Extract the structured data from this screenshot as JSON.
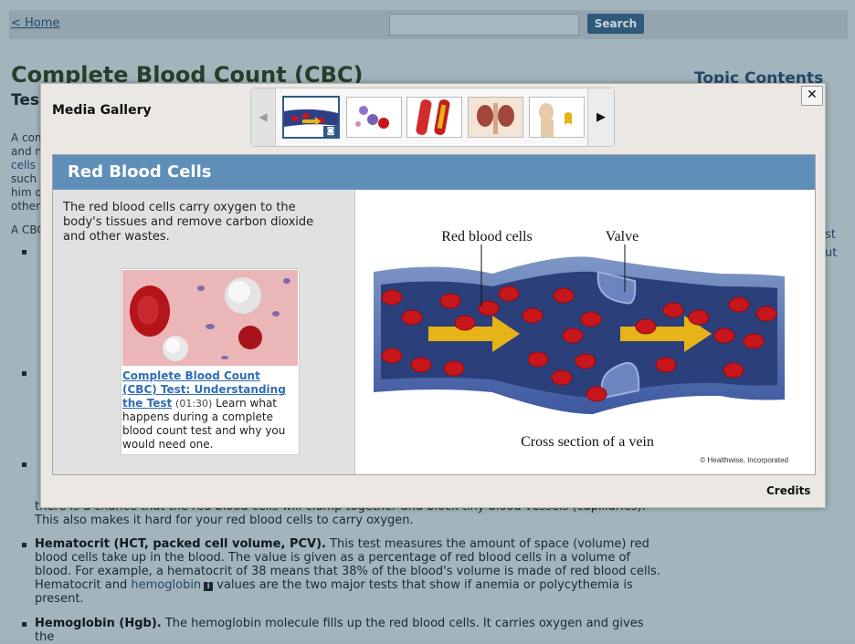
{
  "background": {
    "home_link": "< Home",
    "search_button": "Search",
    "title": "Complete Blood Count (CBC)",
    "subtitle_fragment": "Tes",
    "topic_contents": "Topic Contents",
    "side_link_1": "est",
    "side_link_2": "out",
    "left_fragments": [
      "A com",
      "and n",
      "cells",
      "such",
      "him o",
      "other",
      "A CBC"
    ],
    "paragraph_rbc_tail": "there is a chance that the red blood cells will clump together and block tiny blood vessels (capillaries). This also makes it hard for your red blood cells to carry oxygen.",
    "hematocrit_term": "Hematocrit (HCT, packed cell volume, PCV).",
    "hematocrit_text_1": " This test measures the amount of space (volume) red blood cells take up in the blood. The value is given as a percentage of red blood cells in a volume of blood. For example, a hematocrit of 38 means that 38% of the blood's volume is made of red blood cells. Hematocrit and ",
    "hematocrit_link": "hemoglobin",
    "hematocrit_text_2": " values are the two major tests that show if anemia or polycythemia is present.",
    "hemoglobin_term": "Hemoglobin (Hgb).",
    "hemoglobin_text": " The hemoglobin molecule fills up the red blood cells. It carries oxygen and gives the"
  },
  "modal": {
    "title": "Media Gallery",
    "close_label": "✕",
    "section_title": "Red Blood Cells",
    "description": "The red blood cells carry oxygen to the body's tissues and remove carbon dioxide and other wastes.",
    "video": {
      "link_text": "Complete Blood Count (CBC) Test: Understanding the Test",
      "duration": "(01:30)",
      "description": "Learn what happens during a complete blood count test and why you would need one."
    },
    "diagram": {
      "label_cells": "Red blood cells",
      "label_valve": "Valve",
      "caption": "Cross section of a vein",
      "copyright": "© Healthwise, Incorporated"
    },
    "credits": "Credits"
  },
  "colors": {
    "accent": "#5f8fb9",
    "link": "#2f6db3",
    "vein": "#2b3f7a",
    "cell": "#c8171c",
    "arrow": "#e6b318"
  },
  "icons": [
    "chevron-left-icon",
    "chevron-right-icon",
    "close-icon",
    "camera-icon",
    "info-icon"
  ]
}
